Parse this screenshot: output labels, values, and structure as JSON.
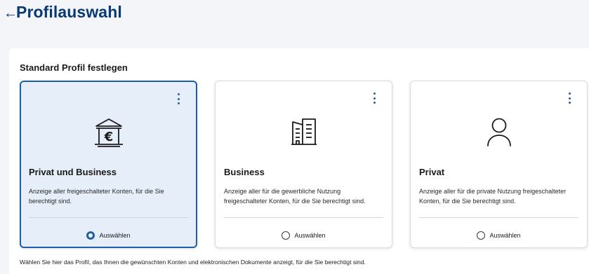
{
  "header": {
    "back_icon": "←",
    "title": "Profilauswahl"
  },
  "section": {
    "title": "Standard Profil festlegen"
  },
  "cards": [
    {
      "icon": "bank-euro-icon",
      "title": "Privat und Business",
      "description": "Anzeige aller freigeschalteter Konten, für die Sie berechtigt sind.",
      "select_label": "Auswählen",
      "selected": true
    },
    {
      "icon": "office-building-icon",
      "title": "Business",
      "description": "Anzeige aller für die gewerbliche Nutzung freigeschalteter Konten, für die Sie berechtigt sind.",
      "select_label": "Auswählen",
      "selected": false
    },
    {
      "icon": "person-icon",
      "title": "Privat",
      "description": "Anzeige aller für die private Nutzung freigeschalteter Konten, für die Sie berechtigt sind.",
      "select_label": "Auswählen",
      "selected": false
    }
  ],
  "footer": {
    "text": "Wählen Sie hier das Profil, das Ihnen die gewünschten Konten und elektronischen Dokumente anzeigt, für die Sie berechtigt sind."
  },
  "colors": {
    "primary": "#0a3a75",
    "accent": "#1f5fa8",
    "selected_bg": "#e5eef9",
    "page_bg": "#f3f5f8"
  }
}
